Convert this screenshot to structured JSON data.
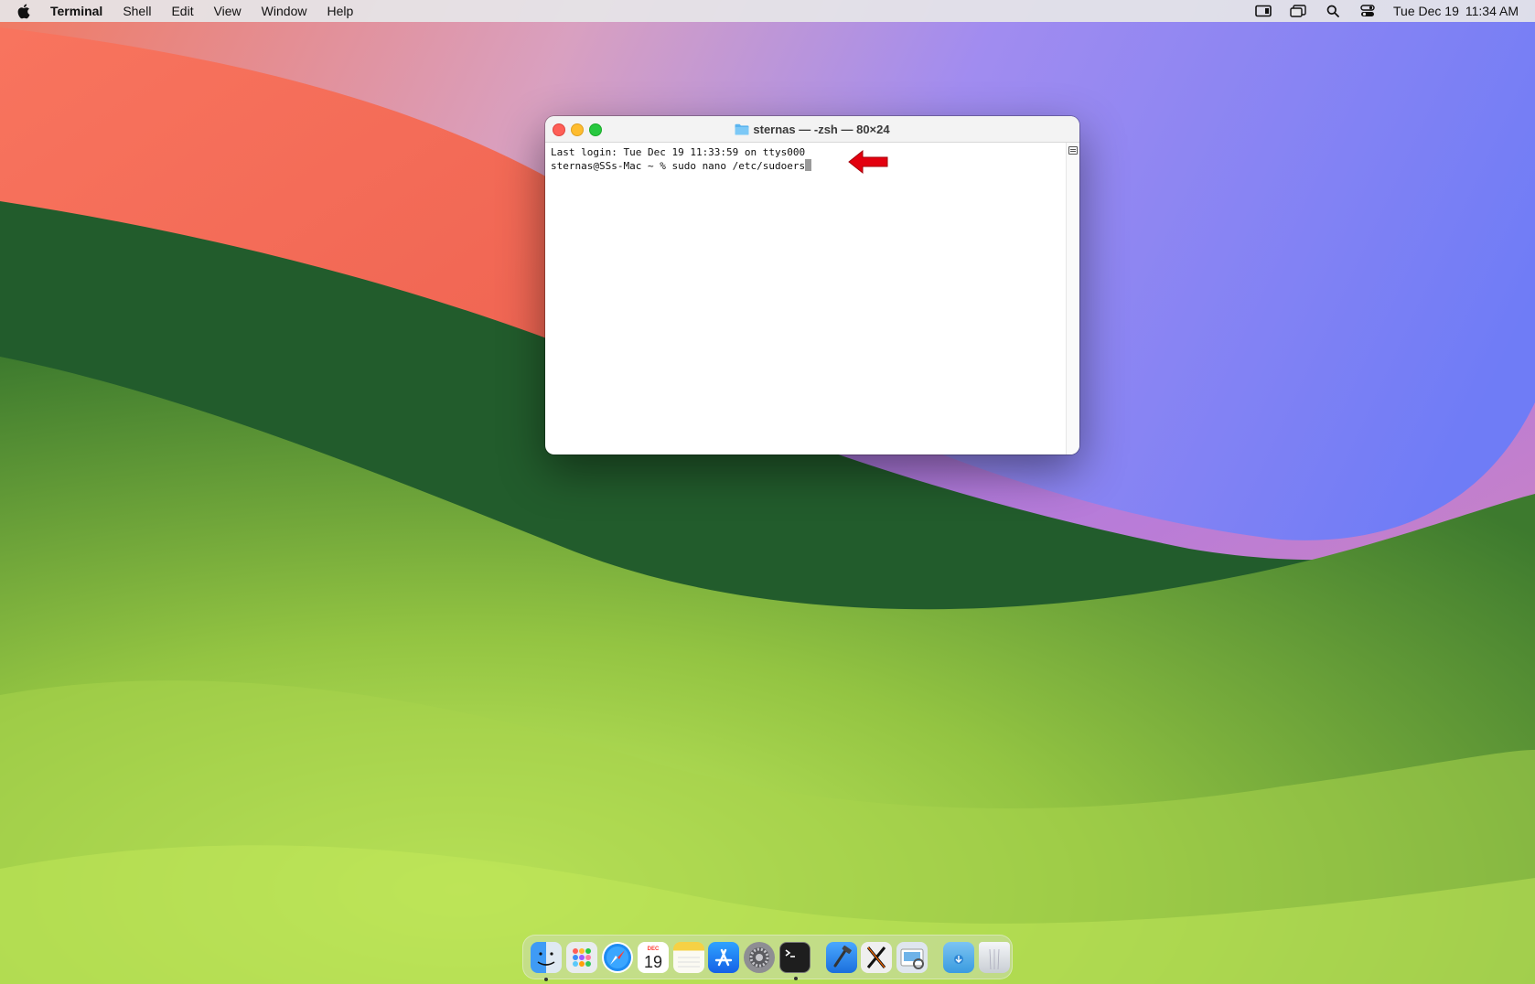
{
  "menubar": {
    "app_name": "Terminal",
    "menus": [
      "Shell",
      "Edit",
      "View",
      "Window",
      "Help"
    ],
    "clock_date": "Tue Dec 19",
    "clock_time": "11:34 AM",
    "status_icons": [
      "screen-mirroring-icon",
      "stage-manager-icon",
      "spotlight-search-icon",
      "control-center-icon"
    ]
  },
  "window": {
    "title": "sternas — -zsh — 80×24",
    "lines": [
      "Last login: Tue Dec 19 11:33:59 on ttys000",
      "sternas@SSs-Mac ~ % sudo nano /etc/sudoers"
    ]
  },
  "dock": {
    "items": [
      "Finder",
      "Launchpad",
      "Safari",
      "Calendar",
      "Notes",
      "App Store",
      "System Settings",
      "Terminal",
      "Xcode",
      "X11",
      "Preview",
      "Downloads",
      "Trash"
    ],
    "calendar_month": "DEC",
    "calendar_day": "19",
    "running": [
      "Finder",
      "Terminal"
    ]
  },
  "colors": {
    "arrow": "#e3000f",
    "close": "#fe5f57",
    "minimize": "#febc2e",
    "maximize": "#28c840"
  }
}
